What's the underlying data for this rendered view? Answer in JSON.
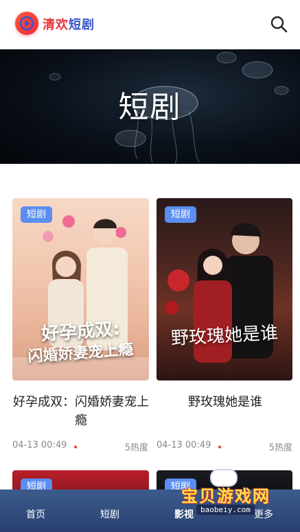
{
  "header": {
    "app_name_part1": "清欢",
    "app_name_part2": "短剧",
    "search_icon": "search-icon",
    "logo_icon": "play-logo-icon"
  },
  "banner": {
    "title": "短剧"
  },
  "cards": [
    {
      "badge": "短剧",
      "poster_text_line1": "好孕成双:",
      "poster_text_line2": "闪婚娇妻宠上瘾",
      "title": "好孕成双：闪婚娇妻宠上瘾",
      "date": "04-13 00:49",
      "heat": "5热度"
    },
    {
      "badge": "短剧",
      "poster_text_line1": "野玫瑰她是谁",
      "title": "野玫瑰她是谁",
      "date": "04-13 00:49",
      "heat": "5热度"
    },
    {
      "badge": "短剧"
    },
    {
      "badge": "短剧"
    }
  ],
  "tabbar": {
    "items": [
      {
        "label": "首页"
      },
      {
        "label": "短剧"
      },
      {
        "label": "影视"
      },
      {
        "label": "更多"
      }
    ]
  },
  "watermark": {
    "title": "宝贝游戏网",
    "url": "baobeiy.com"
  },
  "colors": {
    "brand_red": "#e8343c",
    "brand_blue": "#3b54c9",
    "badge_blue": "#5b8ef0",
    "tabbar_bg": "#34507f"
  }
}
